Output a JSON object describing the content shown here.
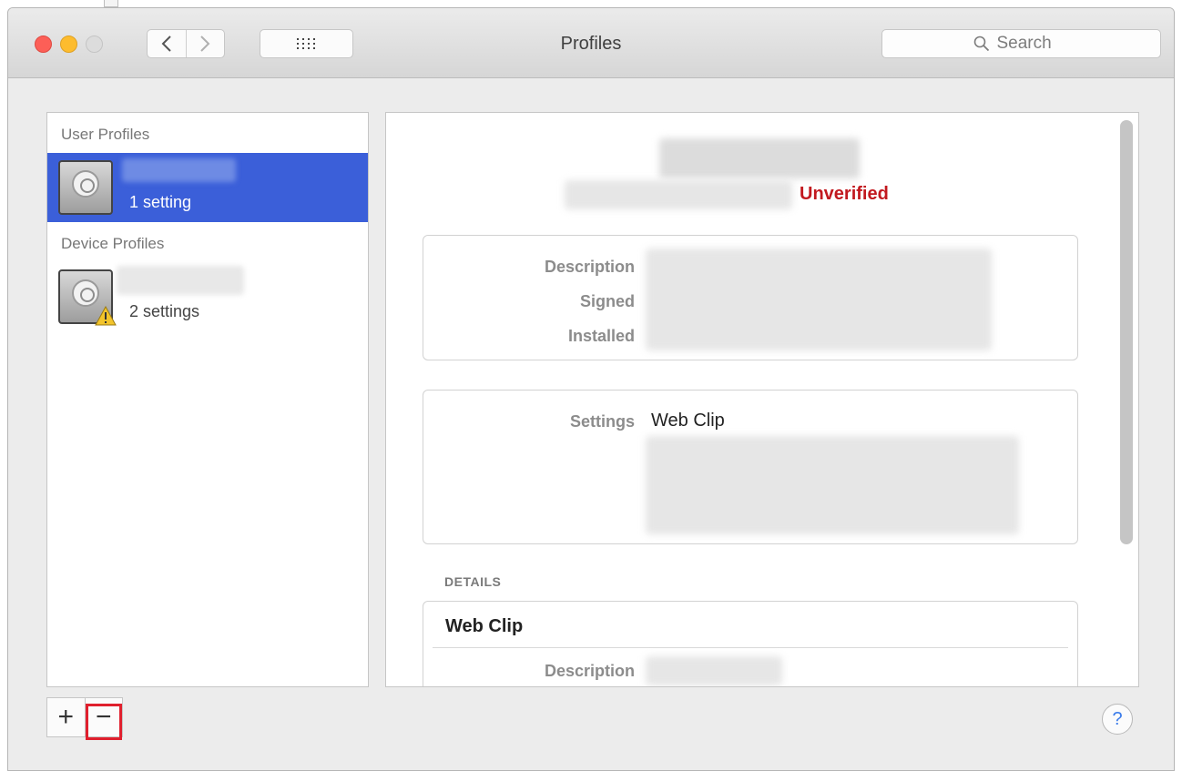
{
  "window": {
    "title": "Profiles"
  },
  "toolbar": {
    "back_icon": "chevron-left-icon",
    "forward_icon": "chevron-right-icon",
    "grid_icon": "grid-dots-icon",
    "search_placeholder": "Search"
  },
  "sidebar": {
    "user_header": "User Profiles",
    "device_header": "Device Profiles",
    "user_profiles": [
      {
        "settings_count": "1 setting",
        "selected": true
      }
    ],
    "device_profiles": [
      {
        "settings_count": "2 settings",
        "warning": true
      }
    ]
  },
  "detail": {
    "status": "Unverified",
    "labels": {
      "description": "Description",
      "signed": "Signed",
      "installed": "Installed"
    },
    "settings_label": "Settings",
    "settings_value": "Web Clip",
    "details_heading": "DETAILS",
    "payload": {
      "title": "Web Clip",
      "description_label": "Description"
    }
  },
  "bottombar": {
    "add_label": "+",
    "remove_label": "−",
    "help_label": "?"
  },
  "colors": {
    "selection": "#3b5fd9",
    "unverified": "#c2191f",
    "highlight": "#e0202e",
    "help": "#3a7bea"
  }
}
